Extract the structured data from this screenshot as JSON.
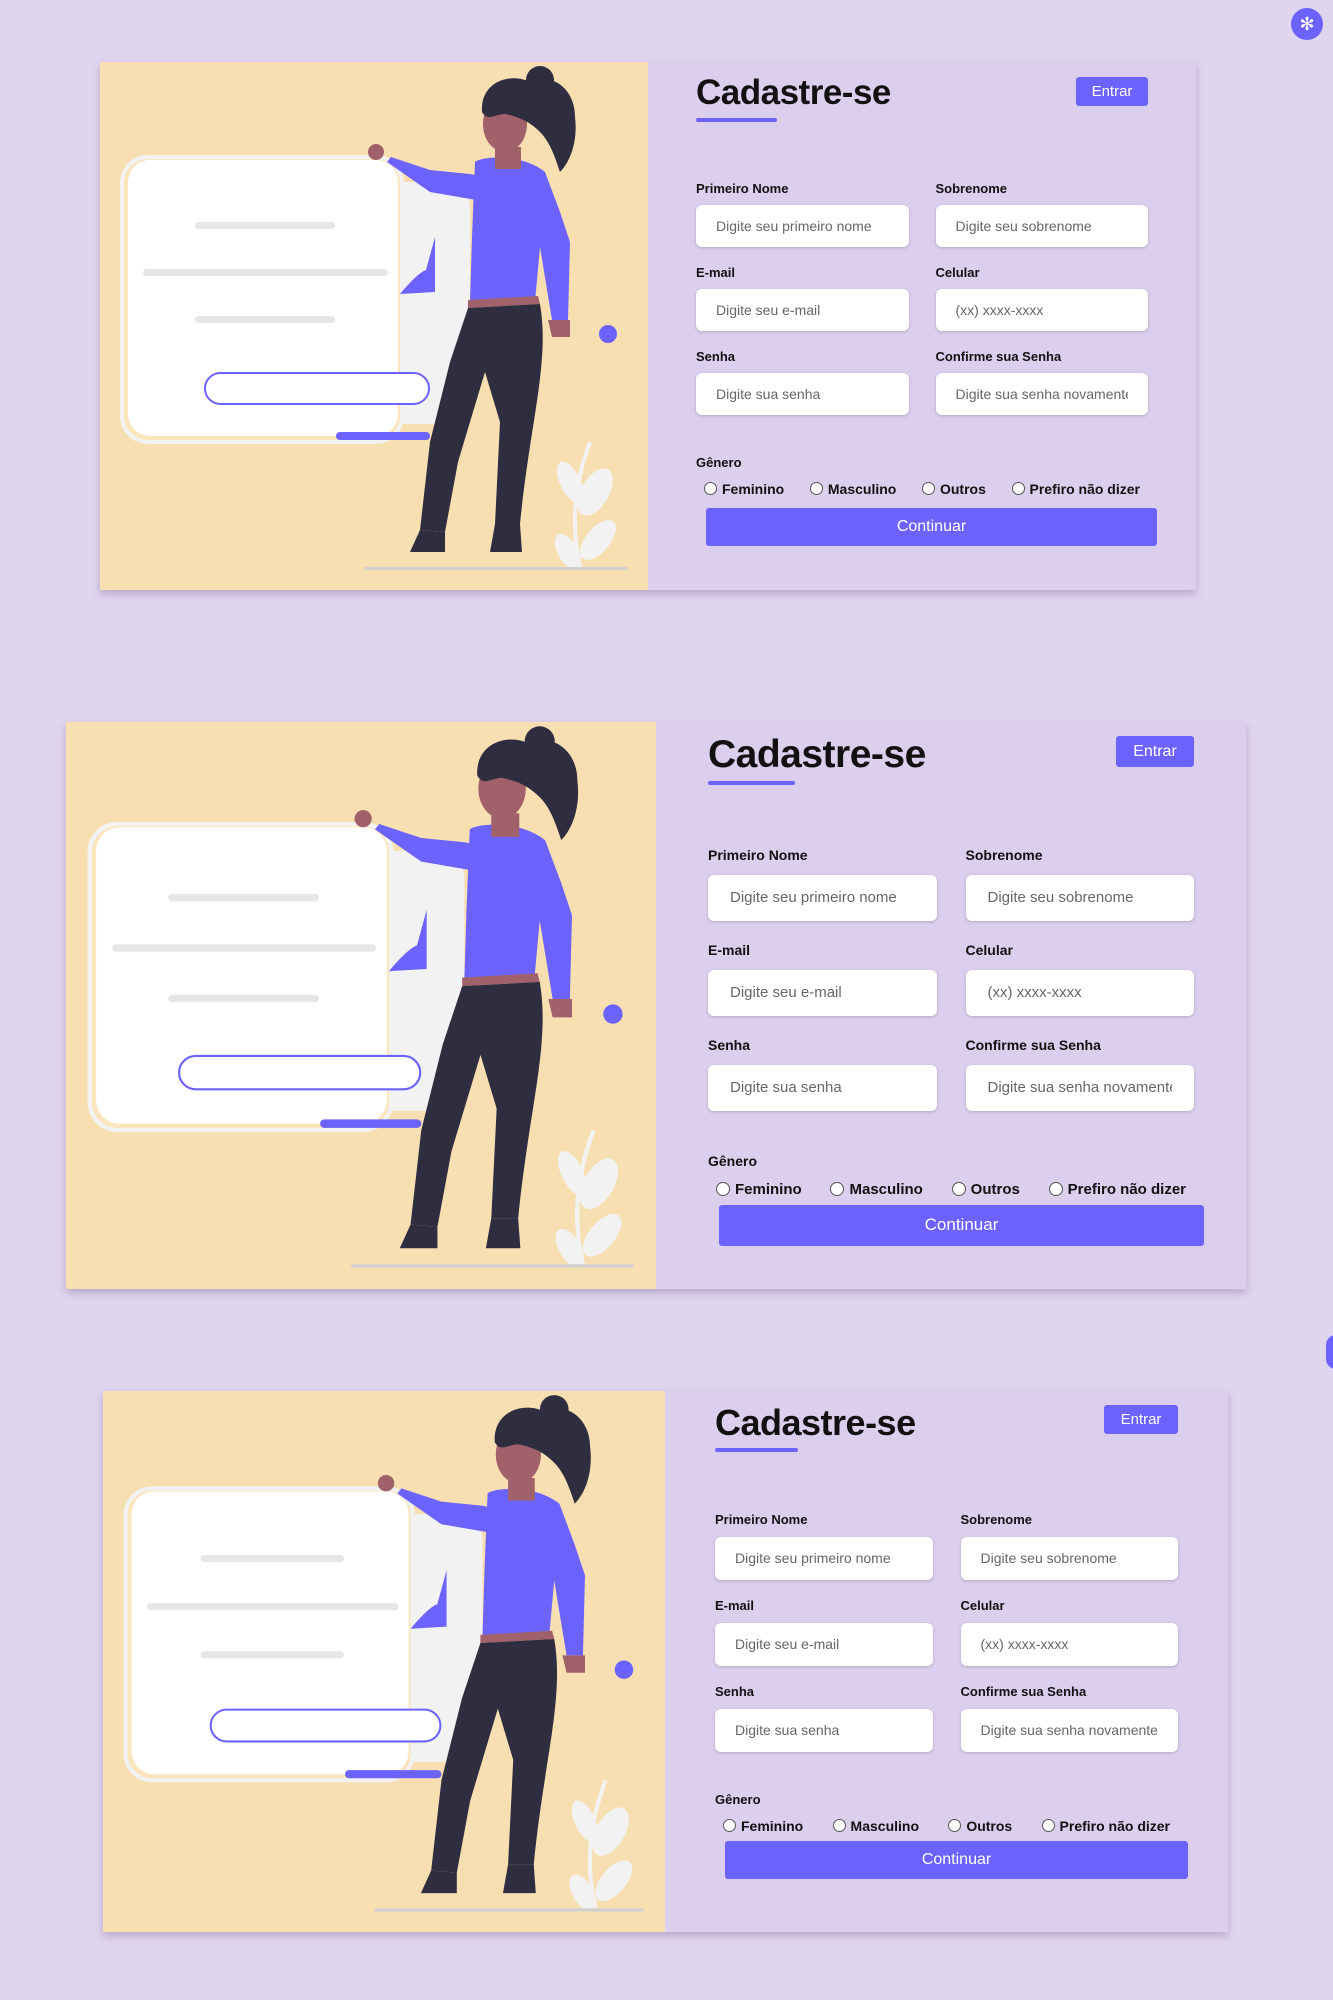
{
  "settings": {
    "icon": "gear-icon"
  },
  "colors": {
    "accent": "#6c63ff",
    "page_bg": "#e0d5ef",
    "form_bg": "#dccfee",
    "illustration_bg": "#f8dfb2"
  },
  "form": {
    "title": "Cadastre-se",
    "login_label": "Entrar",
    "first_name_label": "Primeiro Nome",
    "first_name_placeholder": "Digite seu primeiro nome",
    "last_name_label": "Sobrenome",
    "last_name_placeholder": "Digite seu sobrenome",
    "email_label": "E-mail",
    "email_placeholder": "Digite seu e-mail",
    "phone_label": "Celular",
    "phone_placeholder": "(xx) xxxx-xxxx",
    "password_label": "Senha",
    "password_placeholder": "Digite sua senha",
    "confirm_label": "Confirme sua Senha",
    "confirm_placeholder": "Digite sua senha novamente",
    "gender_title": "Gênero",
    "gender_options": [
      "Feminino",
      "Masculino",
      "Outros",
      "Prefiro não dizer"
    ],
    "submit_label": "Continuar"
  }
}
